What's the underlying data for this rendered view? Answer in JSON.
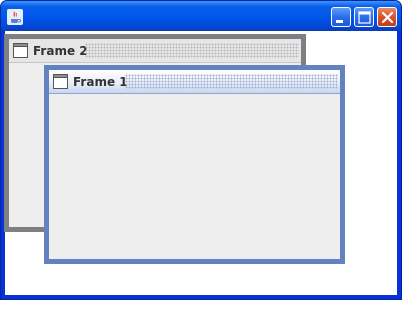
{
  "window": {
    "icon": "java-icon",
    "controls": [
      "minimize-icon",
      "maximize-icon",
      "close-icon"
    ]
  },
  "frames": [
    {
      "title": "Frame 2",
      "icon": "frame-window-icon",
      "active": false
    },
    {
      "title": "Frame 1",
      "icon": "frame-window-icon",
      "active": true
    }
  ],
  "colors": {
    "titlebar": "#0058ee",
    "close_button": "#d9542a",
    "active_frame_border": "#6382bf",
    "inactive_frame_border": "#7d7f82",
    "frame_content": "#eeeeee"
  }
}
